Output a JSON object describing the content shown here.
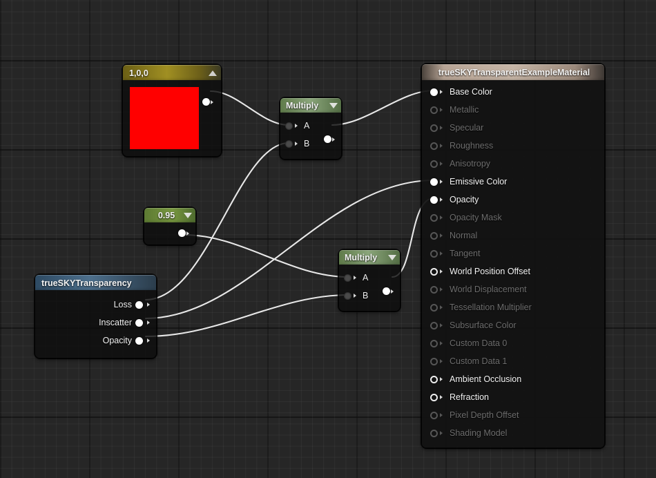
{
  "editor": {
    "name": "material-graph-editor",
    "background": "#262626",
    "grid_color": "#2f2f2f"
  },
  "nodes": {
    "constant_color": {
      "title": "1,0,0",
      "color_value": "#ff0000",
      "collapse_icon": "triangle-up-icon",
      "output_pin": "output"
    },
    "scalar": {
      "title": "0.95",
      "collapse_icon": "triangle-down-icon",
      "output_pin": "output"
    },
    "multiply_1": {
      "title": "Multiply",
      "collapse_icon": "triangle-down-icon",
      "inputs": [
        {
          "label": "A"
        },
        {
          "label": "B"
        }
      ],
      "output_pin": "output"
    },
    "multiply_2": {
      "title": "Multiply",
      "collapse_icon": "triangle-down-icon",
      "inputs": [
        {
          "label": "A"
        },
        {
          "label": "B"
        }
      ],
      "output_pin": "output"
    },
    "truesky_transparency": {
      "title": "trueSKYTransparency",
      "outputs": [
        {
          "label": "Loss"
        },
        {
          "label": "Inscatter"
        },
        {
          "label": "Opacity"
        }
      ]
    },
    "material_output": {
      "title": "trueSKYTransparentExampleMaterial",
      "inputs": [
        {
          "label": "Base Color",
          "state": "connected"
        },
        {
          "label": "Metallic",
          "state": "disabled"
        },
        {
          "label": "Specular",
          "state": "disabled"
        },
        {
          "label": "Roughness",
          "state": "disabled"
        },
        {
          "label": "Anisotropy",
          "state": "disabled"
        },
        {
          "label": "Emissive Color",
          "state": "connected"
        },
        {
          "label": "Opacity",
          "state": "connected"
        },
        {
          "label": "Opacity Mask",
          "state": "disabled"
        },
        {
          "label": "Normal",
          "state": "disabled"
        },
        {
          "label": "Tangent",
          "state": "disabled"
        },
        {
          "label": "World Position Offset",
          "state": "enabled"
        },
        {
          "label": "World Displacement",
          "state": "disabled"
        },
        {
          "label": "Tessellation Multiplier",
          "state": "disabled"
        },
        {
          "label": "Subsurface Color",
          "state": "disabled"
        },
        {
          "label": "Custom Data 0",
          "state": "disabled"
        },
        {
          "label": "Custom Data 1",
          "state": "disabled"
        },
        {
          "label": "Ambient Occlusion",
          "state": "enabled"
        },
        {
          "label": "Refraction",
          "state": "enabled"
        },
        {
          "label": "Pixel Depth Offset",
          "state": "disabled"
        },
        {
          "label": "Shading Model",
          "state": "disabled"
        }
      ]
    }
  },
  "connections": [
    {
      "from": "constant_color.output",
      "to": "multiply_1.A"
    },
    {
      "from": "truesky_transparency.Loss",
      "to": "multiply_1.B"
    },
    {
      "from": "multiply_1.output",
      "to": "material_output.Base Color"
    },
    {
      "from": "truesky_transparency.Inscatter",
      "to": "material_output.Emissive Color"
    },
    {
      "from": "scalar.output",
      "to": "multiply_2.A"
    },
    {
      "from": "truesky_transparency.Opacity",
      "to": "multiply_2.B"
    },
    {
      "from": "multiply_2.output",
      "to": "material_output.Opacity"
    }
  ]
}
